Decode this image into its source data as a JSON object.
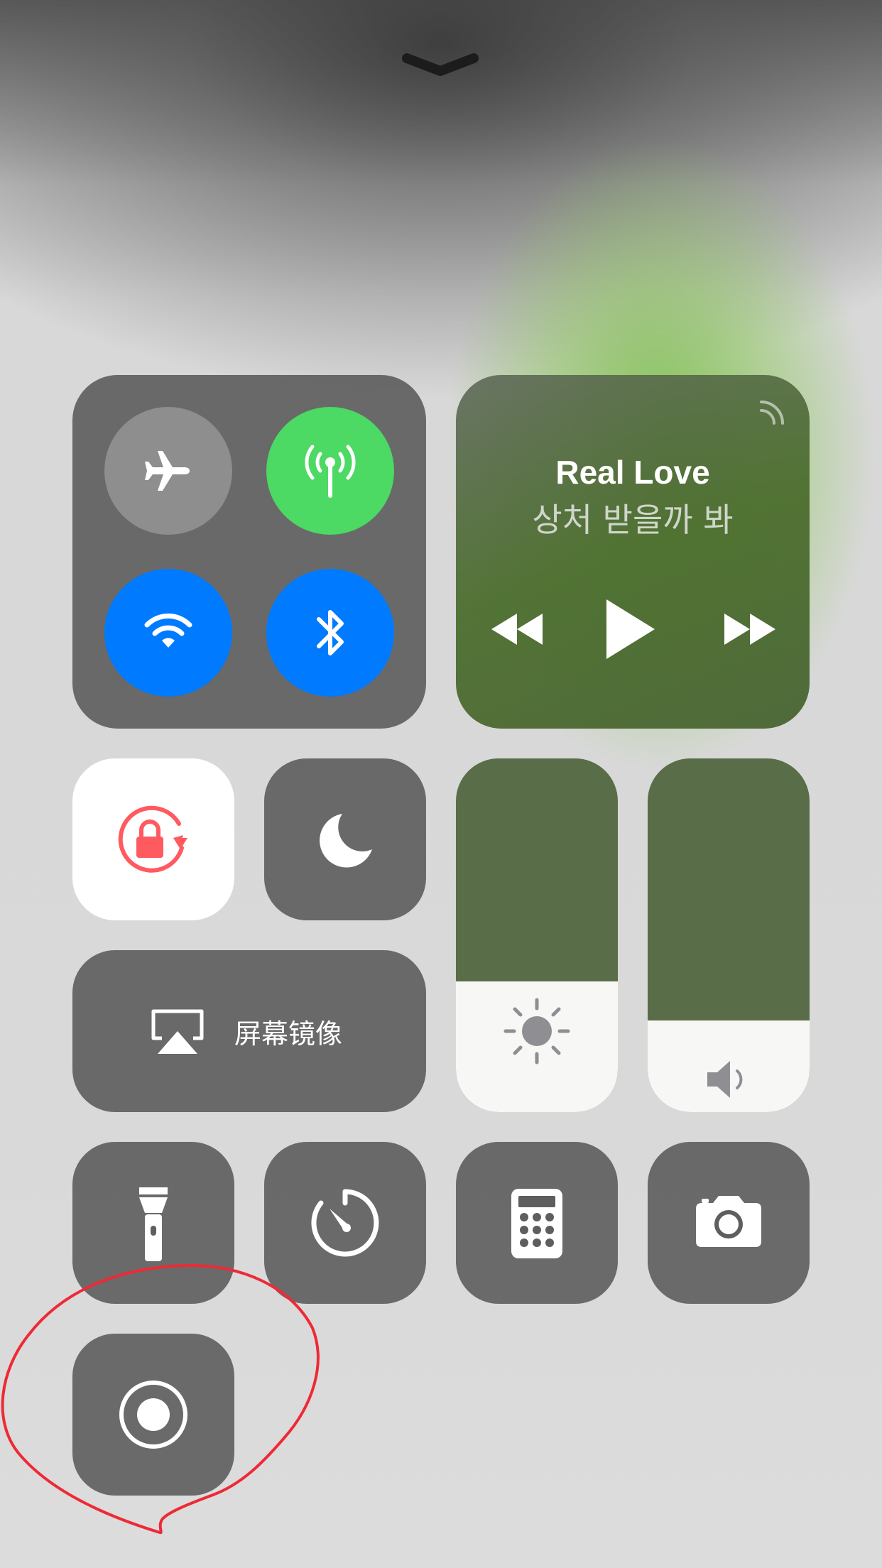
{
  "control_center": {
    "dismiss_icon": "chevron-down-icon",
    "connectivity": {
      "airplane": {
        "icon": "airplane-icon",
        "state": "off",
        "color": "#8e8e8e"
      },
      "cellular": {
        "icon": "cellular-antenna-icon",
        "state": "on",
        "color": "#4cd964"
      },
      "wifi": {
        "icon": "wifi-icon",
        "state": "on",
        "color": "#007aff"
      },
      "bluetooth": {
        "icon": "bluetooth-icon",
        "state": "on",
        "color": "#007aff"
      }
    },
    "now_playing": {
      "title": "Real Love",
      "artist": "상처 받을까 봐",
      "airplay_icon": "airplay-audio-icon",
      "controls": [
        "rewind-icon",
        "play-icon",
        "fast-forward-icon"
      ]
    },
    "orientation_lock": {
      "icon": "rotation-lock-icon",
      "state": "on",
      "color": "#ff5a5f"
    },
    "do_not_disturb": {
      "icon": "moon-icon",
      "state": "off"
    },
    "screen_mirroring": {
      "label": "屏幕镜像",
      "icon": "airplay-screen-icon"
    },
    "brightness": {
      "icon": "sun-icon",
      "level": 0.37
    },
    "volume": {
      "icon": "speaker-icon",
      "level": 0.26
    },
    "shortcuts": [
      "flashlight-icon",
      "timer-icon",
      "calculator-icon",
      "camera-icon"
    ],
    "screen_recording": {
      "icon": "screen-record-icon",
      "annotation_color": "#ee2a35"
    }
  }
}
